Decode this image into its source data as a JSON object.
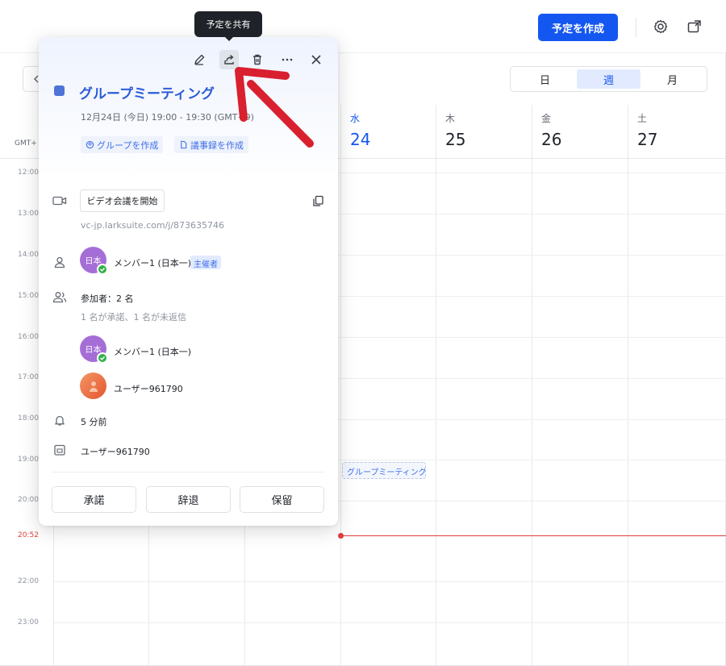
{
  "topbar": {
    "create_label": "予定を作成"
  },
  "subbar": {
    "view_day": "日",
    "view_week": "週",
    "view_month": "月"
  },
  "timezone_label": "GMT+",
  "days": [
    {
      "dow": "水",
      "dom": "24"
    },
    {
      "dow": "木",
      "dom": "25"
    },
    {
      "dow": "金",
      "dom": "26"
    },
    {
      "dow": "土",
      "dom": "27"
    }
  ],
  "hours": [
    "12:00",
    "13:00",
    "14:00",
    "15:00",
    "16:00",
    "17:00",
    "18:00",
    "19:00",
    "20:00",
    "20:52",
    "22:00",
    "23:00"
  ],
  "grid_event_label": "グループミーティング",
  "tooltip": "予定を共有",
  "popover": {
    "title": "グループミーティング",
    "time": "12月24日 (今日) 19:00 - 19:30 (GMT+9)",
    "chip_group": "グループを作成",
    "chip_minutes": "議事録を作成",
    "video_button": "ビデオ会議を開始",
    "video_link": "vc-jp.larksuite.com/j/873635746",
    "organizer_name": "メンバー1 (日本一)",
    "organizer_tag": "主催者",
    "avatar_text": "日本",
    "participants_label": "参加者：2 名",
    "participants_status": "1 名が承諾、1 名が未返信",
    "participant1": "メンバー1 (日本一)",
    "participant2": "ユーザー961790",
    "reminder": "5 分前",
    "calendar_owner": "ユーザー961790",
    "accept": "承諾",
    "decline": "辞退",
    "tentative": "保留"
  },
  "colors": {
    "accent": "#1456f0",
    "now_line": "#e03e3e",
    "annotation_arrow": "#d9202f"
  }
}
